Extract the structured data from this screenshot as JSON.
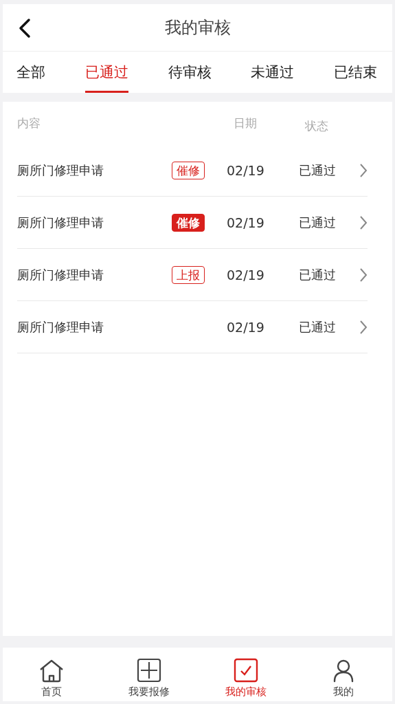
{
  "header": {
    "title": "我的审核"
  },
  "tabs": [
    {
      "label": "全部",
      "selected": false
    },
    {
      "label": "已通过",
      "selected": true
    },
    {
      "label": "待审核",
      "selected": false
    },
    {
      "label": "未通过",
      "selected": false
    },
    {
      "label": "已结束",
      "selected": false
    }
  ],
  "table": {
    "columns": [
      "内容",
      "日期",
      "状态"
    ],
    "rows": [
      {
        "content": "厕所门修理申请",
        "tag": {
          "label": "催修",
          "kind": "outline"
        },
        "date": "02/19",
        "status": "已通过"
      },
      {
        "content": "厕所门修理申请",
        "tag": {
          "label": "催修",
          "kind": "filled"
        },
        "date": "02/19",
        "status": "已通过"
      },
      {
        "content": "厕所门修理申请",
        "tag": {
          "label": "上报",
          "kind": "outline"
        },
        "date": "02/19",
        "status": "已通过"
      },
      {
        "content": "厕所门修理申请",
        "date": "02/19",
        "status": "已通过"
      }
    ]
  },
  "nav": [
    {
      "label": "首页",
      "selected": false
    },
    {
      "label": "我要报修",
      "selected": false
    },
    {
      "label": "我的审核",
      "selected": true
    },
    {
      "label": "我的",
      "selected": false
    }
  ]
}
